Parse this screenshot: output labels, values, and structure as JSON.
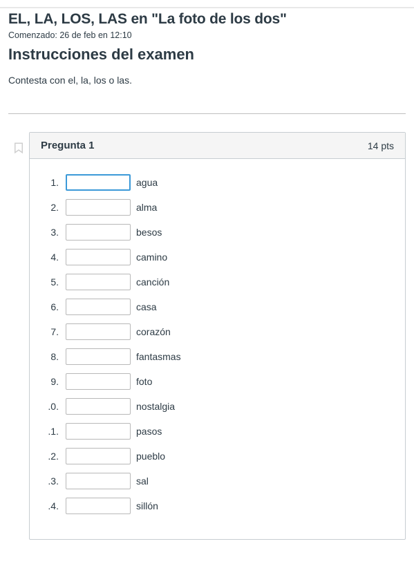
{
  "quiz_title": "EL, LA, LOS, LAS en \"La foto de los dos\"",
  "started_line": "Comenzado: 26 de feb en 12:10",
  "instructions_heading": "Instrucciones del examen",
  "instructions_body": "Contesta con el, la, los o las.",
  "question": {
    "title": "Pregunta 1",
    "points": "14 pts"
  },
  "items": [
    {
      "num": "1.",
      "word": "agua",
      "value": "",
      "selected": true
    },
    {
      "num": "2.",
      "word": "alma",
      "value": "",
      "selected": false
    },
    {
      "num": "3.",
      "word": "besos",
      "value": "",
      "selected": false
    },
    {
      "num": "4.",
      "word": "camino",
      "value": "",
      "selected": false
    },
    {
      "num": "5.",
      "word": "canción",
      "value": "",
      "selected": false
    },
    {
      "num": "6.",
      "word": "casa",
      "value": "",
      "selected": false
    },
    {
      "num": "7.",
      "word": "corazón",
      "value": "",
      "selected": false
    },
    {
      "num": "8.",
      "word": "fantasmas",
      "value": "",
      "selected": false
    },
    {
      "num": "9.",
      "word": "foto",
      "value": "",
      "selected": false
    },
    {
      "num": ".0.",
      "word": "nostalgia",
      "value": "",
      "selected": false
    },
    {
      "num": ".1.",
      "word": "pasos",
      "value": "",
      "selected": false
    },
    {
      "num": ".2.",
      "word": "pueblo",
      "value": "",
      "selected": false
    },
    {
      "num": ".3.",
      "word": "sal",
      "value": "",
      "selected": false
    },
    {
      "num": ".4.",
      "word": "sillón",
      "value": "",
      "selected": false
    }
  ]
}
